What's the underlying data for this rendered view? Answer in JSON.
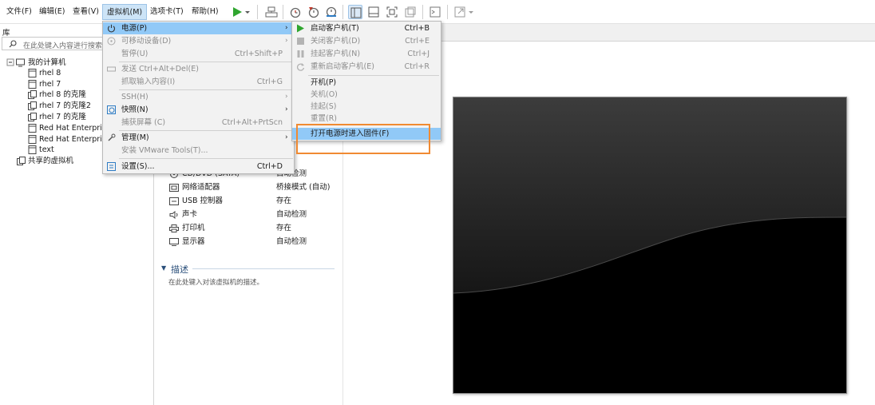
{
  "menubar": {
    "items": [
      "文件(F)",
      "编辑(E)",
      "查看(V)",
      "虚拟机(M)",
      "选项卡(T)",
      "帮助(H)"
    ]
  },
  "library": {
    "title": "库",
    "search_placeholder": "在此处键入内容进行搜索",
    "tree": [
      "我的计算机",
      "rhel 8",
      "rhel 7",
      "rhel 8 的克隆",
      "rhel 7 的克隆2",
      "rhel 7 的克隆",
      "Red Hat Enterprise",
      "Red Hat Enterprise",
      "text",
      "共享的虚拟机"
    ]
  },
  "hardware": {
    "rows": [
      {
        "name": "CD/DVD (SATA)",
        "value": "自动检测"
      },
      {
        "name": "网络适配器",
        "value": "桥接模式 (自动)"
      },
      {
        "name": "USB 控制器",
        "value": "存在"
      },
      {
        "name": "声卡",
        "value": "自动检测"
      },
      {
        "name": "打印机",
        "value": "存在"
      },
      {
        "name": "显示器",
        "value": "自动检测"
      }
    ]
  },
  "description": {
    "title": "描述",
    "placeholder": "在此处键入对该虚拟机的描述。"
  },
  "vm_menu": {
    "items": [
      {
        "label": "电源(P)",
        "shortcut": "",
        "submenu": true,
        "disabled": false
      },
      {
        "label": "可移动设备(D)",
        "shortcut": "",
        "submenu": true,
        "disabled": true
      },
      {
        "label": "暂停(U)",
        "shortcut": "Ctrl+Shift+P",
        "submenu": false,
        "disabled": true
      },
      {
        "label": "发送 Ctrl+Alt+Del(E)",
        "shortcut": "",
        "submenu": false,
        "disabled": true
      },
      {
        "label": "抓取输入内容(I)",
        "shortcut": "Ctrl+G",
        "submenu": false,
        "disabled": true
      },
      {
        "label": "SSH(H)",
        "shortcut": "",
        "submenu": true,
        "disabled": true
      },
      {
        "label": "快照(N)",
        "shortcut": "",
        "submenu": true,
        "disabled": false
      },
      {
        "label": "捕获屏幕 (C)",
        "shortcut": "Ctrl+Alt+PrtScn",
        "submenu": false,
        "disabled": true
      },
      {
        "label": "管理(M)",
        "shortcut": "",
        "submenu": true,
        "disabled": false
      },
      {
        "label": "安装 VMware Tools(T)...",
        "shortcut": "",
        "submenu": false,
        "disabled": true
      },
      {
        "label": "设置(S)...",
        "shortcut": "Ctrl+D",
        "submenu": false,
        "disabled": false
      }
    ]
  },
  "power_menu": {
    "items": [
      {
        "label": "启动客户机(T)",
        "shortcut": "Ctrl+B",
        "disabled": false
      },
      {
        "label": "关闭客户机(D)",
        "shortcut": "Ctrl+E",
        "disabled": true
      },
      {
        "label": "挂起客户机(N)",
        "shortcut": "Ctrl+J",
        "disabled": true
      },
      {
        "label": "重新启动客户机(E)",
        "shortcut": "Ctrl+R",
        "disabled": true
      },
      {
        "label": "开机(P)",
        "shortcut": "",
        "disabled": false
      },
      {
        "label": "关机(O)",
        "shortcut": "",
        "disabled": true
      },
      {
        "label": "挂起(S)",
        "shortcut": "",
        "disabled": true
      },
      {
        "label": "重置(R)",
        "shortcut": "",
        "disabled": true
      },
      {
        "label": "打开电源时进入固件(F)",
        "shortcut": "",
        "disabled": false
      }
    ]
  },
  "colors": {
    "accent": "#f08a32",
    "menu_highlight": "#91c9f7",
    "play_green": "#2fa52f"
  }
}
